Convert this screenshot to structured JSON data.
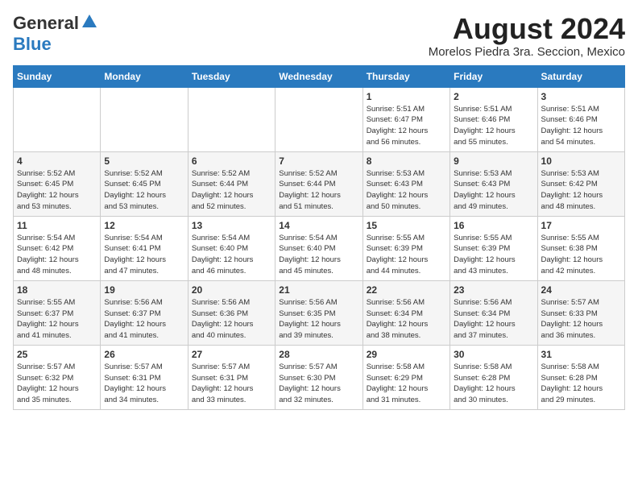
{
  "logo": {
    "general": "General",
    "blue": "Blue"
  },
  "title": {
    "month_year": "August 2024",
    "location": "Morelos Piedra 3ra. Seccion, Mexico"
  },
  "header_days": [
    "Sunday",
    "Monday",
    "Tuesday",
    "Wednesday",
    "Thursday",
    "Friday",
    "Saturday"
  ],
  "weeks": [
    {
      "days": [
        {
          "date": "",
          "info": ""
        },
        {
          "date": "",
          "info": ""
        },
        {
          "date": "",
          "info": ""
        },
        {
          "date": "",
          "info": ""
        },
        {
          "date": "1",
          "info": "Sunrise: 5:51 AM\nSunset: 6:47 PM\nDaylight: 12 hours\nand 56 minutes."
        },
        {
          "date": "2",
          "info": "Sunrise: 5:51 AM\nSunset: 6:46 PM\nDaylight: 12 hours\nand 55 minutes."
        },
        {
          "date": "3",
          "info": "Sunrise: 5:51 AM\nSunset: 6:46 PM\nDaylight: 12 hours\nand 54 minutes."
        }
      ]
    },
    {
      "days": [
        {
          "date": "4",
          "info": "Sunrise: 5:52 AM\nSunset: 6:45 PM\nDaylight: 12 hours\nand 53 minutes."
        },
        {
          "date": "5",
          "info": "Sunrise: 5:52 AM\nSunset: 6:45 PM\nDaylight: 12 hours\nand 53 minutes."
        },
        {
          "date": "6",
          "info": "Sunrise: 5:52 AM\nSunset: 6:44 PM\nDaylight: 12 hours\nand 52 minutes."
        },
        {
          "date": "7",
          "info": "Sunrise: 5:52 AM\nSunset: 6:44 PM\nDaylight: 12 hours\nand 51 minutes."
        },
        {
          "date": "8",
          "info": "Sunrise: 5:53 AM\nSunset: 6:43 PM\nDaylight: 12 hours\nand 50 minutes."
        },
        {
          "date": "9",
          "info": "Sunrise: 5:53 AM\nSunset: 6:43 PM\nDaylight: 12 hours\nand 49 minutes."
        },
        {
          "date": "10",
          "info": "Sunrise: 5:53 AM\nSunset: 6:42 PM\nDaylight: 12 hours\nand 48 minutes."
        }
      ]
    },
    {
      "days": [
        {
          "date": "11",
          "info": "Sunrise: 5:54 AM\nSunset: 6:42 PM\nDaylight: 12 hours\nand 48 minutes."
        },
        {
          "date": "12",
          "info": "Sunrise: 5:54 AM\nSunset: 6:41 PM\nDaylight: 12 hours\nand 47 minutes."
        },
        {
          "date": "13",
          "info": "Sunrise: 5:54 AM\nSunset: 6:40 PM\nDaylight: 12 hours\nand 46 minutes."
        },
        {
          "date": "14",
          "info": "Sunrise: 5:54 AM\nSunset: 6:40 PM\nDaylight: 12 hours\nand 45 minutes."
        },
        {
          "date": "15",
          "info": "Sunrise: 5:55 AM\nSunset: 6:39 PM\nDaylight: 12 hours\nand 44 minutes."
        },
        {
          "date": "16",
          "info": "Sunrise: 5:55 AM\nSunset: 6:39 PM\nDaylight: 12 hours\nand 43 minutes."
        },
        {
          "date": "17",
          "info": "Sunrise: 5:55 AM\nSunset: 6:38 PM\nDaylight: 12 hours\nand 42 minutes."
        }
      ]
    },
    {
      "days": [
        {
          "date": "18",
          "info": "Sunrise: 5:55 AM\nSunset: 6:37 PM\nDaylight: 12 hours\nand 41 minutes."
        },
        {
          "date": "19",
          "info": "Sunrise: 5:56 AM\nSunset: 6:37 PM\nDaylight: 12 hours\nand 41 minutes."
        },
        {
          "date": "20",
          "info": "Sunrise: 5:56 AM\nSunset: 6:36 PM\nDaylight: 12 hours\nand 40 minutes."
        },
        {
          "date": "21",
          "info": "Sunrise: 5:56 AM\nSunset: 6:35 PM\nDaylight: 12 hours\nand 39 minutes."
        },
        {
          "date": "22",
          "info": "Sunrise: 5:56 AM\nSunset: 6:34 PM\nDaylight: 12 hours\nand 38 minutes."
        },
        {
          "date": "23",
          "info": "Sunrise: 5:56 AM\nSunset: 6:34 PM\nDaylight: 12 hours\nand 37 minutes."
        },
        {
          "date": "24",
          "info": "Sunrise: 5:57 AM\nSunset: 6:33 PM\nDaylight: 12 hours\nand 36 minutes."
        }
      ]
    },
    {
      "days": [
        {
          "date": "25",
          "info": "Sunrise: 5:57 AM\nSunset: 6:32 PM\nDaylight: 12 hours\nand 35 minutes."
        },
        {
          "date": "26",
          "info": "Sunrise: 5:57 AM\nSunset: 6:31 PM\nDaylight: 12 hours\nand 34 minutes."
        },
        {
          "date": "27",
          "info": "Sunrise: 5:57 AM\nSunset: 6:31 PM\nDaylight: 12 hours\nand 33 minutes."
        },
        {
          "date": "28",
          "info": "Sunrise: 5:57 AM\nSunset: 6:30 PM\nDaylight: 12 hours\nand 32 minutes."
        },
        {
          "date": "29",
          "info": "Sunrise: 5:58 AM\nSunset: 6:29 PM\nDaylight: 12 hours\nand 31 minutes."
        },
        {
          "date": "30",
          "info": "Sunrise: 5:58 AM\nSunset: 6:28 PM\nDaylight: 12 hours\nand 30 minutes."
        },
        {
          "date": "31",
          "info": "Sunrise: 5:58 AM\nSunset: 6:28 PM\nDaylight: 12 hours\nand 29 minutes."
        }
      ]
    }
  ]
}
